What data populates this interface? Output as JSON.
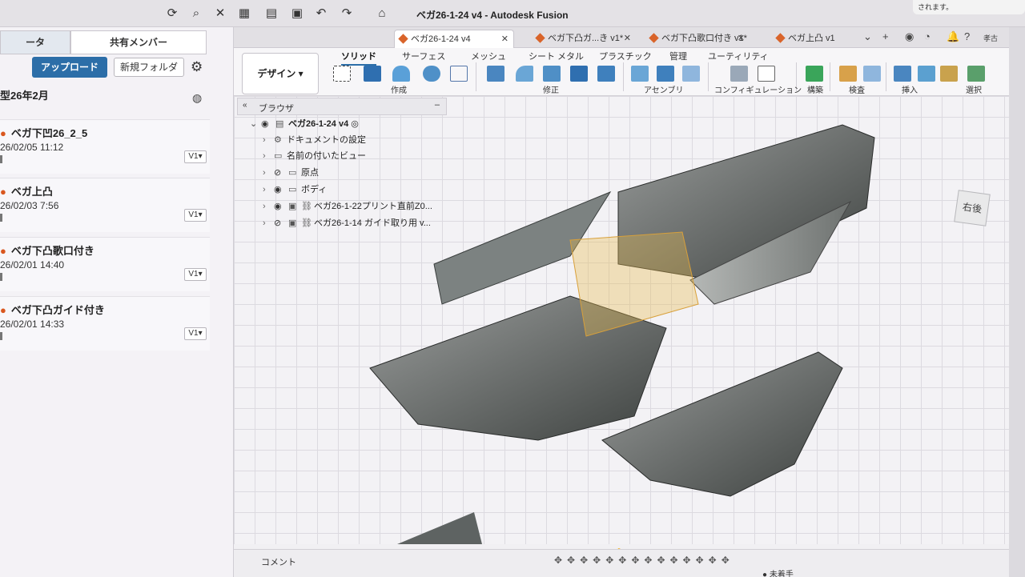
{
  "window": {
    "title": "ベガ26-1-24 v4 - Autodesk Fusion"
  },
  "notification": {
    "text": "されます。"
  },
  "left_panel": {
    "tabs": [
      "ータ",
      "共有メンバー"
    ],
    "upload_label": "アップロード",
    "new_folder_label": "新規フォルダ",
    "month_header": "型26年2月",
    "files": [
      {
        "name": "ベガ下凹26_2_5",
        "date": "26/02/05 11:12",
        "version": "V1▾"
      },
      {
        "name": "ベガ上凸",
        "date": "26/02/03 7:56",
        "version": "V1▾"
      },
      {
        "name": "ベガ下凸歌口付き",
        "date": "26/02/01 14:40",
        "version": "V1▾"
      },
      {
        "name": "ベガ下凸ガイド付き",
        "date": "26/02/01 14:33",
        "version": "V1▾"
      }
    ]
  },
  "doc_tabs": [
    {
      "label": "ベガ26-1-24 v4",
      "active": true
    },
    {
      "label": "ベガ下凸ガ...き v1*",
      "active": false
    },
    {
      "label": "ベガ下凸歌口付き v1*",
      "active": false
    },
    {
      "label": "ベガ上凸 v1",
      "active": false
    }
  ],
  "user_initials": "孝古",
  "toolbar": {
    "workspace": "デザイン",
    "tabs": [
      "ソリッド",
      "サーフェス",
      "メッシュ",
      "シート メタル",
      "プラスチック",
      "管理",
      "ユーティリティ"
    ],
    "groups": [
      "作成",
      "修正",
      "アセンブリ",
      "コンフィギュレーション",
      "構築",
      "検査",
      "挿入",
      "選択"
    ]
  },
  "browser": {
    "title": "ブラウザ",
    "root": "ベガ26-1-24 v4",
    "items": [
      "ドキュメントの設定",
      "名前の付いたビュー",
      "原点",
      "ボディ",
      "ベガ26-1-22プリント直前Z0...",
      "ベガ26-1-14 ガイド取り用 v..."
    ]
  },
  "viewcube": {
    "face": "右",
    "face2": "後"
  },
  "timeline": {
    "comment_label": "コメント",
    "status": "未着手"
  }
}
